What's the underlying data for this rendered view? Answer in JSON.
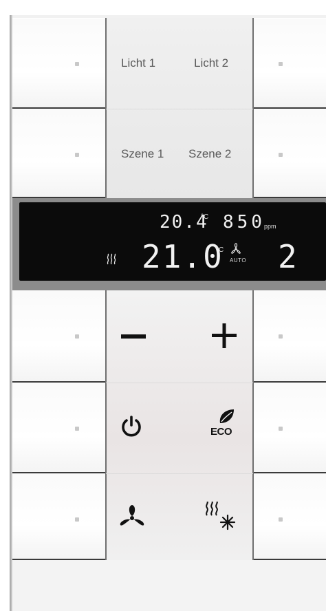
{
  "top_buttons": {
    "row1_left": "Licht 1",
    "row1_right": "Licht 2",
    "row2_left": "Szene 1",
    "row2_right": "Szene 2"
  },
  "display": {
    "measured_temperature": "20.4",
    "measured_temperature_unit": "°C",
    "co2_value": "850",
    "co2_unit": "ppm",
    "setpoint_temperature": "21.0",
    "setpoint_unit": "°C",
    "fan_mode": "AUTO",
    "fan_level": "2",
    "heating_icon": "heating-waves-icon",
    "fan_icon": "fan-icon"
  },
  "controls": {
    "minus_icon": "minus-icon",
    "plus_icon": "plus-icon",
    "power_icon": "power-icon",
    "eco_icon": "eco-leaf-icon",
    "eco_label": "ECO",
    "fan_icon": "fan-icon",
    "heat_cool_icon": "heat-cool-icon"
  },
  "colors": {
    "display_background": "#0b0b0b",
    "display_text": "#f2f2f2",
    "button_face": "#ffffff",
    "center_column": "#eaeaea"
  }
}
